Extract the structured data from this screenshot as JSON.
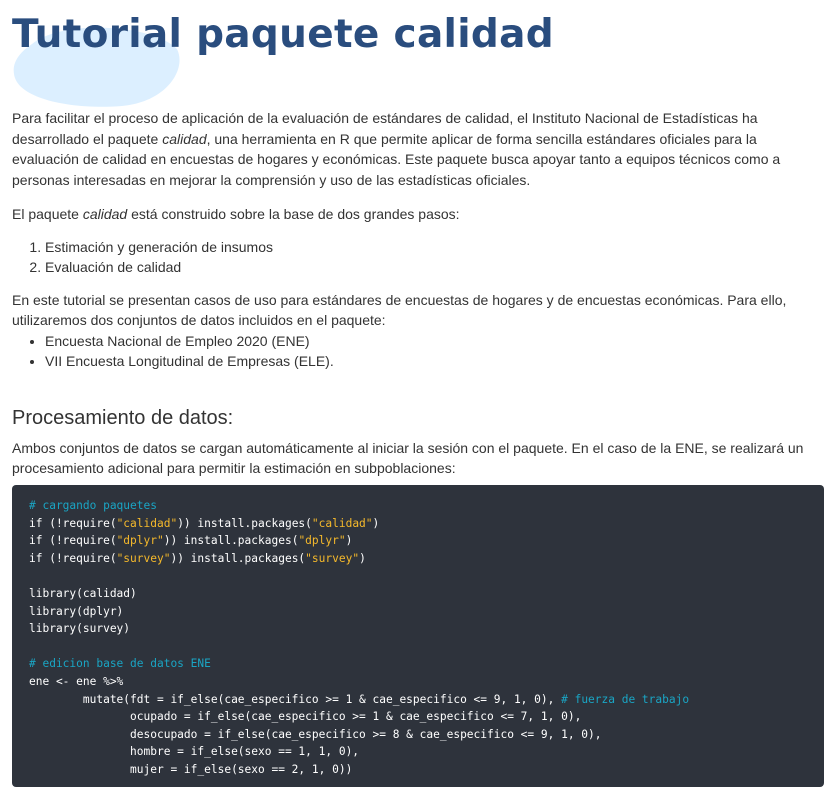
{
  "title": "Tutorial paquete calidad",
  "intro": {
    "t1": "Para facilitar el proceso de aplicación de la evaluación de estándares de calidad, el Instituto Nacional de Estadísticas ha desarrollado el paquete ",
    "em": "calidad",
    "t2": ", una herramienta en R que permite aplicar de forma sencilla estándares oficiales para la evaluación de calidad en encuestas de hogares y económicas. Este paquete busca apoyar tanto a equipos técnicos como a personas interesadas en mejorar la comprensión y uso de las estadísticas oficiales."
  },
  "pasos_intro": {
    "t1": "El paquete ",
    "em": "calidad",
    "t2": " está construido sobre la base de dos grandes pasos:"
  },
  "pasos": [
    "Estimación y generación de insumos",
    "Evaluación de calidad"
  ],
  "datos_intro": "En este tutorial se presentan casos de uso para estándares de encuestas de hogares y de encuestas económicas. Para ello, utilizaremos dos conjuntos de datos incluidos en el paquete:",
  "datos": [
    "Encuesta Nacional de Empleo 2020 (ENE)",
    "VII Encuesta Longitudinal de Empresas (ELE)."
  ],
  "section": {
    "heading": "Procesamiento de datos:",
    "text": "Ambos conjuntos de datos se cargan automáticamente al iniciar la sesión con el paquete. En el caso de la ENE, se realizará un procesamiento adicional para permitir la estimación en subpoblaciones:"
  },
  "code": {
    "c1": "# cargando paquetes",
    "r1a": "if (!require(",
    "r1s": "\"calidad\"",
    "r1b": ")) install.packages(",
    "r1s2": "\"calidad\"",
    "r1c": ")",
    "r2a": "if (!require(",
    "r2s": "\"dplyr\"",
    "r2b": ")) install.packages(",
    "r2s2": "\"dplyr\"",
    "r2c": ")",
    "r3a": "if (!require(",
    "r3s": "\"survey\"",
    "r3b": ")) install.packages(",
    "r3s2": "\"survey\"",
    "r3c": ")",
    "l1": "library(calidad)",
    "l2": "library(dplyr)",
    "l3": "library(survey)",
    "c2": "# edicion base de datos ENE",
    "e1": "ene <- ene %>%",
    "e2": "        mutate(fdt = if_else(cae_especifico >= 1 & cae_especifico <= 9, 1, 0), ",
    "e2c": "# fuerza de trabajo",
    "e3": "               ocupado = if_else(cae_especifico >= 1 & cae_especifico <= 7, 1, 0),",
    "e4": "               desocupado = if_else(cae_especifico >= 8 & cae_especifico <= 9, 1, 0),",
    "e5": "               hombre = if_else(sexo == 1, 1, 0),",
    "e6": "               mujer = if_else(sexo == 2, 1, 0))"
  }
}
